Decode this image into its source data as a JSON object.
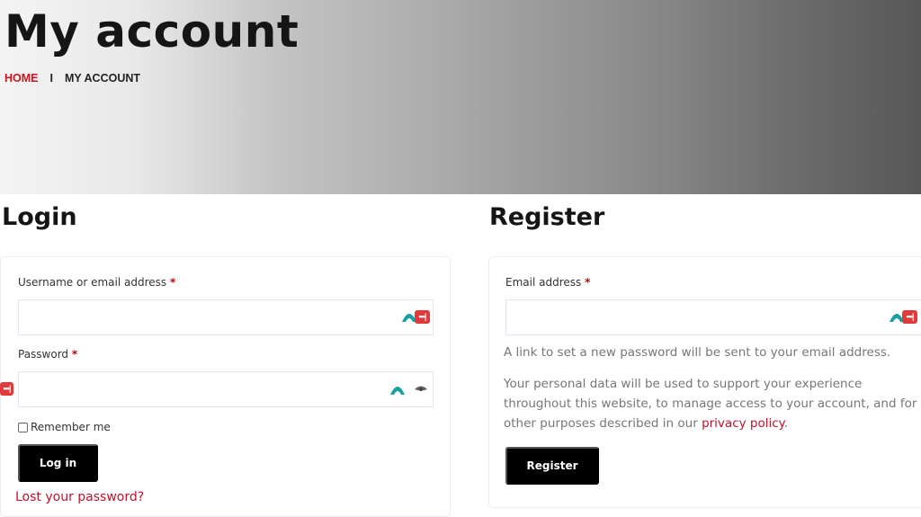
{
  "hero": {
    "title": "My account",
    "breadcrumb": {
      "home": "HOME",
      "separator": "I",
      "current": "MY ACCOUNT"
    }
  },
  "login": {
    "title": "Login",
    "username_label": "Username or email address",
    "username_value": "",
    "password_label": "Password",
    "password_value": "",
    "required_mark": "*",
    "remember_label": "Remember me",
    "remember_checked": false,
    "submit_label": "Log in",
    "lost_password_label": "Lost your password?"
  },
  "register": {
    "title": "Register",
    "email_label": "Email address",
    "email_value": "",
    "required_mark": "*",
    "notice": "A link to set a new password will be sent to your email address.",
    "privacy_prefix": "Your personal data will be used to support your experience throughout this website, to manage access to your account, and for other purposes described in our ",
    "privacy_link": "privacy policy",
    "privacy_suffix": ".",
    "submit_label": "Register"
  },
  "icons": {
    "autofill_dots": "•••|"
  },
  "colors": {
    "accent_red": "#d0141c",
    "link_red": "#c0132b",
    "button_bg": "#000000",
    "password_manager_teal": "#1aa0a0",
    "password_manager_red": "#e03a3a"
  }
}
